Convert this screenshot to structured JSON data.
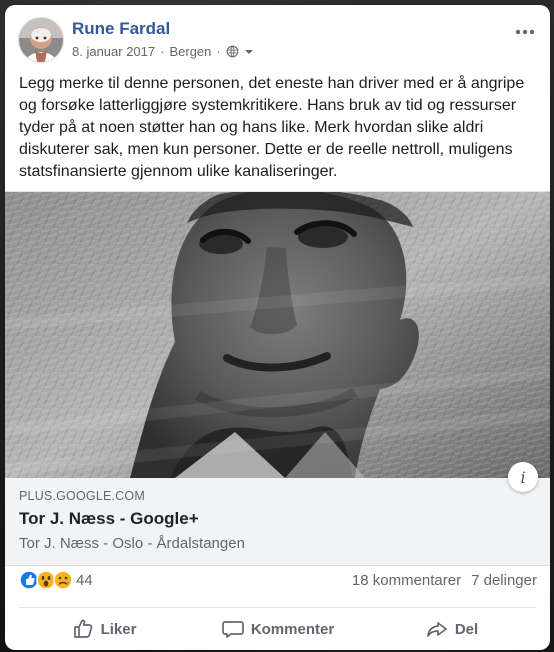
{
  "post": {
    "author": "Rune Fardal",
    "date": "8. januar 2017",
    "location": "Bergen",
    "separator": "·",
    "text": "Legg merke til denne personen, det eneste han driver med er å angripe og forsøke latterliggjøre systemkritikere. Hans bruk av tid og ressurser tyder på at noen støtter han og hans like. Merk hvordan slike aldri diskuterer sak, men kun personer. Dette er de reelle nettroll, muligens statsfinansierte gjennom ulike kanaliseringer.",
    "privacy_icon": "globe-icon",
    "menu_icon": "more-icon"
  },
  "link_preview": {
    "domain": "PLUS.GOOGLE.COM",
    "title": "Tor J. Næss - Google+",
    "subtitle": "Tor J. Næss - Oslo - Årdalstangen",
    "info_label": "i"
  },
  "engagement": {
    "reaction_count": "44",
    "comments": "18 kommentarer",
    "shares": "7 delinger",
    "icons": [
      "like-icon",
      "wow-icon",
      "sad-icon"
    ]
  },
  "actions": {
    "like": "Liker",
    "comment": "Kommenter",
    "share": "Del"
  },
  "colors": {
    "author": "#365899",
    "secondary_text": "#606770",
    "like_blue": "#1877f2",
    "reaction_yellow": "#f7b125"
  }
}
